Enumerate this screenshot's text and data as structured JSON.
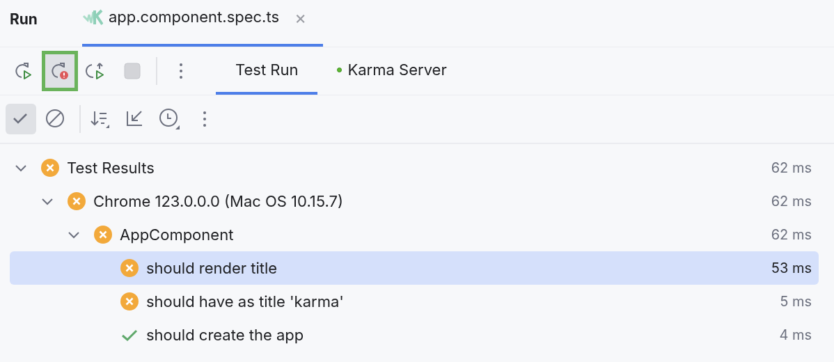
{
  "panel": {
    "title": "Run"
  },
  "file_tabs": [
    {
      "label": "app.component.spec.ts",
      "selected": true,
      "close": "×"
    }
  ],
  "run_toolbar": [
    {
      "kind": "rerun",
      "highlighted": false
    },
    {
      "kind": "rerun-failed",
      "highlighted": true
    },
    {
      "kind": "toggle-auto",
      "highlighted": false
    },
    {
      "kind": "stop",
      "highlighted": false
    },
    {
      "kind": "more",
      "highlighted": false
    }
  ],
  "view_tabs": [
    {
      "label": "Test Run",
      "selected": true,
      "dot": false
    },
    {
      "label": "Karma Server",
      "selected": false,
      "dot": true
    }
  ],
  "filter_toolbar": [
    {
      "kind": "show-passed",
      "checked": true
    },
    {
      "kind": "show-ignored",
      "checked": false
    },
    {
      "kind": "sort",
      "checked": false
    },
    {
      "kind": "collapse",
      "checked": false
    },
    {
      "kind": "history",
      "checked": false
    },
    {
      "kind": "more",
      "checked": false
    }
  ],
  "tree": [
    {
      "label": "Test Results",
      "kind": "failed",
      "time": "62 ms",
      "expanded": true,
      "selected": false,
      "children": [
        {
          "label": "Chrome 123.0.0.0 (Mac OS 10.15.7)",
          "kind": "failed",
          "time": "62 ms",
          "expanded": true,
          "selected": false,
          "children": [
            {
              "label": "AppComponent",
              "kind": "failed",
              "time": "62 ms",
              "expanded": true,
              "selected": false,
              "children": [
                {
                  "label": "should render title",
                  "kind": "failed",
                  "time": "53 ms",
                  "selected": true
                },
                {
                  "label": "should have as title 'karma'",
                  "kind": "failed",
                  "time": "5 ms",
                  "selected": false
                },
                {
                  "label": "should create the app",
                  "kind": "passed",
                  "time": "4 ms",
                  "selected": false
                }
              ]
            }
          ]
        }
      ]
    }
  ]
}
